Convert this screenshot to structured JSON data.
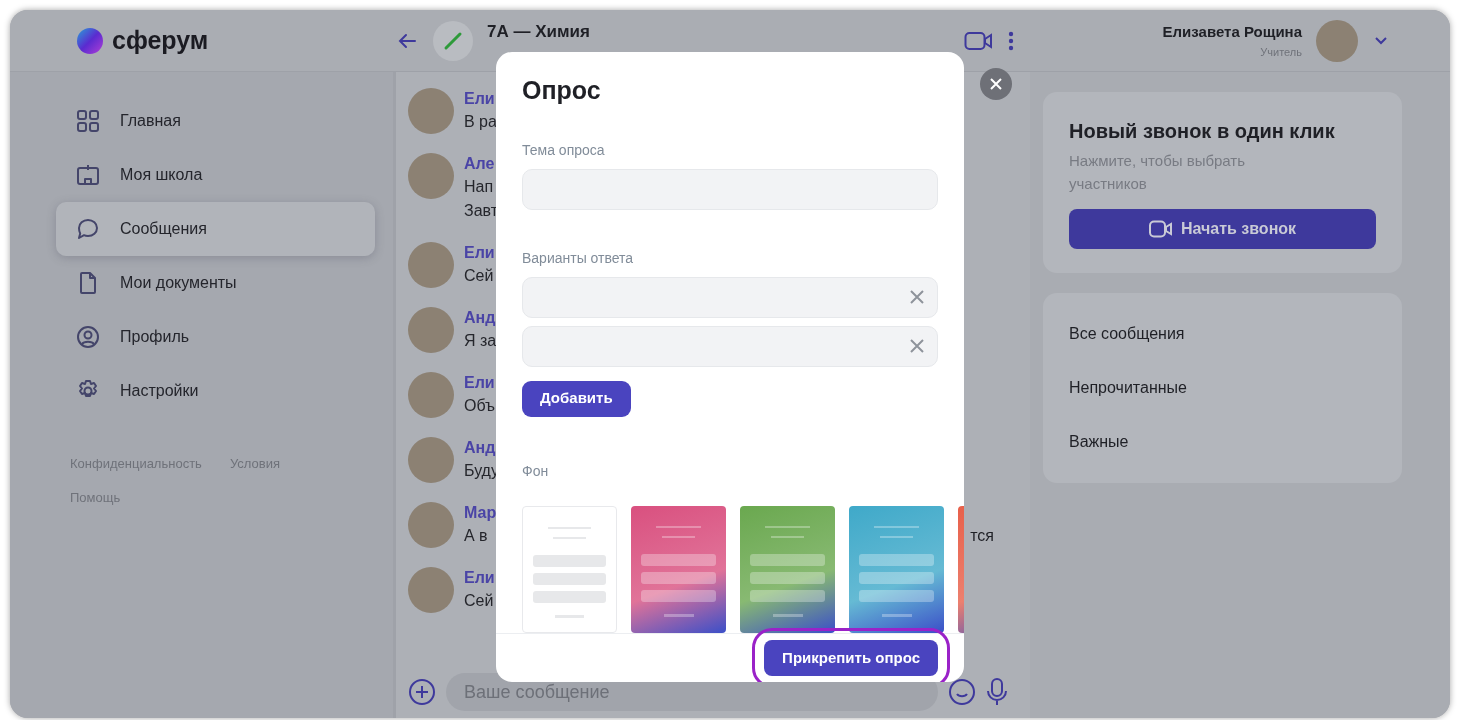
{
  "app": {
    "logo": "сферум"
  },
  "sidebar": {
    "items": [
      {
        "label": "Главная",
        "selected": false
      },
      {
        "label": "Моя школа",
        "selected": false
      },
      {
        "label": "Сообщения",
        "selected": true
      },
      {
        "label": "Мои документы",
        "selected": false
      },
      {
        "label": "Профиль",
        "selected": false
      },
      {
        "label": "Настройки",
        "selected": false
      }
    ],
    "footer_links": [
      "Конфиденциальность",
      "Условия",
      "Помощь"
    ]
  },
  "chat": {
    "title": "7А — Химия",
    "messages": [
      {
        "author": "Ели",
        "lines": [
          "В ра"
        ]
      },
      {
        "author": "Але",
        "lines": [
          "Нап",
          "Завт"
        ]
      },
      {
        "author": "Ели",
        "lines": [
          "Сей"
        ]
      },
      {
        "author": "Анд",
        "lines": [
          "Я за"
        ]
      },
      {
        "author": "Ели",
        "lines": [
          "Объ"
        ]
      },
      {
        "author": "Анд",
        "lines": [
          "Буду"
        ]
      },
      {
        "author": "Мар",
        "lines": [
          "А в"
        ],
        "tail": "тся"
      },
      {
        "author": "Ели",
        "lines": [
          "Сей"
        ]
      }
    ],
    "composer": {
      "placeholder": "Ваше сообщение"
    }
  },
  "user": {
    "name": "Елизавета Рощина",
    "role": "Учитель"
  },
  "call_card": {
    "title": "Новый звонок в один клик",
    "subtitle": "Нажмите, чтобы выбрать участников",
    "button": "Начать звонок"
  },
  "filters": [
    "Все сообщения",
    "Непрочитанные",
    "Важные"
  ],
  "poll_dialog": {
    "title": "Опрос",
    "topic_label": "Тема опроса",
    "answers_label": "Варианты ответа",
    "answers": [
      {
        "removable": true
      },
      {
        "removable": true
      }
    ],
    "add_button": "Добавить",
    "background_label": "Фон",
    "backgrounds": [
      {
        "color": "#ffffff"
      },
      {
        "color": "#d9507f"
      },
      {
        "color": "#6aa84f"
      },
      {
        "color": "#3fa9c9"
      },
      {
        "color": "#e8604a"
      }
    ],
    "submit_button": {
      "label": "Прикрепить опрос",
      "highlighted": true
    }
  }
}
